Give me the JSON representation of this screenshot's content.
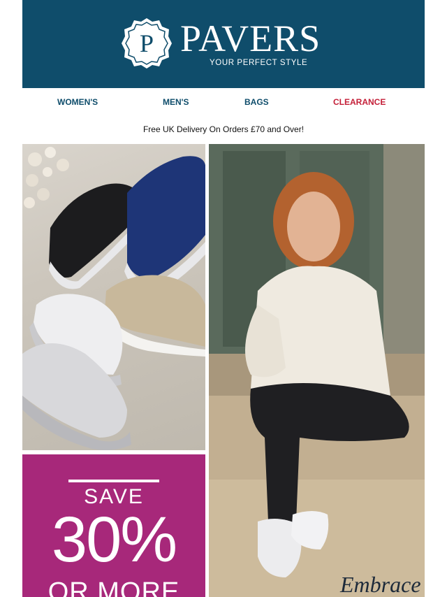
{
  "brand": {
    "logo_letter": "P",
    "name": "PAVERS",
    "tagline": "YOUR PERFECT STYLE",
    "header_color": "#0f4d6b"
  },
  "nav": {
    "items": [
      {
        "label": "WOMEN'S"
      },
      {
        "label": "MEN'S"
      },
      {
        "label": "BAGS"
      },
      {
        "label": "CLEARANCE",
        "color": "#c41f38"
      }
    ]
  },
  "delivery": {
    "text": "Free UK Delivery On Orders £70 and Over!"
  },
  "hero": {
    "promo": {
      "line1": "SAVE",
      "line2": "30%",
      "line3": "OR MORE",
      "bg_color": "#a7287a"
    },
    "script_text": "Embrace"
  }
}
